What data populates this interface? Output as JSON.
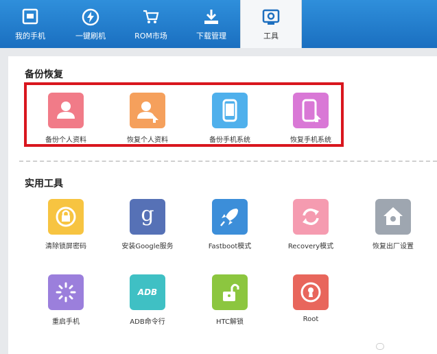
{
  "tabs": [
    {
      "label": "我的手机",
      "icon": "phone-icon"
    },
    {
      "label": "一键刷机",
      "icon": "flash-icon"
    },
    {
      "label": "ROM市场",
      "icon": "cart-icon"
    },
    {
      "label": "下载管理",
      "icon": "download-icon"
    },
    {
      "label": "工具",
      "icon": "tools-icon",
      "active": true
    }
  ],
  "backup": {
    "title": "备份恢复",
    "items": [
      {
        "label": "备份个人资料",
        "color": "#f17b88",
        "icon": "person-icon"
      },
      {
        "label": "恢复个人资料",
        "color": "#f5a05c",
        "icon": "person-restore-icon"
      },
      {
        "label": "备份手机系统",
        "color": "#4fb0ec",
        "icon": "phone-backup-icon"
      },
      {
        "label": "恢复手机系统",
        "color": "#d978d6",
        "icon": "phone-restore-icon"
      }
    ]
  },
  "tools": {
    "title": "实用工具",
    "items": [
      {
        "label": "清除锁屏密码",
        "color": "#f7c441",
        "icon": "unlock-icon"
      },
      {
        "label": "安装Google服务",
        "color": "#5671b6",
        "icon": "google-icon",
        "glyph": "g"
      },
      {
        "label": "Fastboot模式",
        "color": "#3c8ed9",
        "icon": "rocket-icon"
      },
      {
        "label": "Recovery模式",
        "color": "#f59bb0",
        "icon": "refresh-icon"
      },
      {
        "label": "恢复出厂设置",
        "color": "#9ea6b0",
        "icon": "home-icon"
      },
      {
        "label": "重启手机",
        "color": "#9b7fdc",
        "icon": "reboot-icon"
      },
      {
        "label": "ADB命令行",
        "color": "#3fc0c4",
        "icon": "adb-icon",
        "glyph": "ADB"
      },
      {
        "label": "HTC解锁",
        "color": "#8cc63f",
        "icon": "padlock-open-icon"
      },
      {
        "label": "Root",
        "color": "#e8665c",
        "icon": "keyhole-icon"
      }
    ]
  }
}
